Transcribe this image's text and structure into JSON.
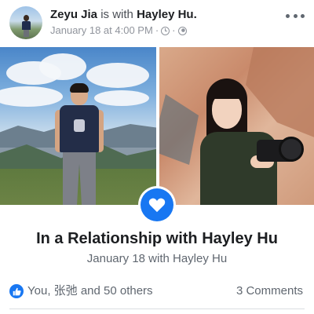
{
  "post": {
    "author": "Zeyu Jia",
    "connector": "is with",
    "tagged": "Hayley Hu.",
    "timestamp": "January 18 at 4:00 PM",
    "separator": "·",
    "icons": [
      "clock-icon",
      "globe-icon",
      "more-options-icon"
    ]
  },
  "photos": [
    {
      "name": "photo-zeyu",
      "description_icon": "photo"
    },
    {
      "name": "photo-hayley",
      "description_icon": "photo"
    }
  ],
  "life_event": {
    "badge_icon": "heart-icon",
    "title": "In a Relationship with Hayley Hu",
    "subtitle": "January 18 with Hayley Hu"
  },
  "footer": {
    "like_icon": "thumbs-up-icon",
    "reactions_text": "You, 张弛 and 50 others",
    "comments_text": "3 Comments"
  },
  "colors": {
    "accent": "#1877f2",
    "secondary_text": "#606770",
    "primary_text": "#1c1e21"
  }
}
